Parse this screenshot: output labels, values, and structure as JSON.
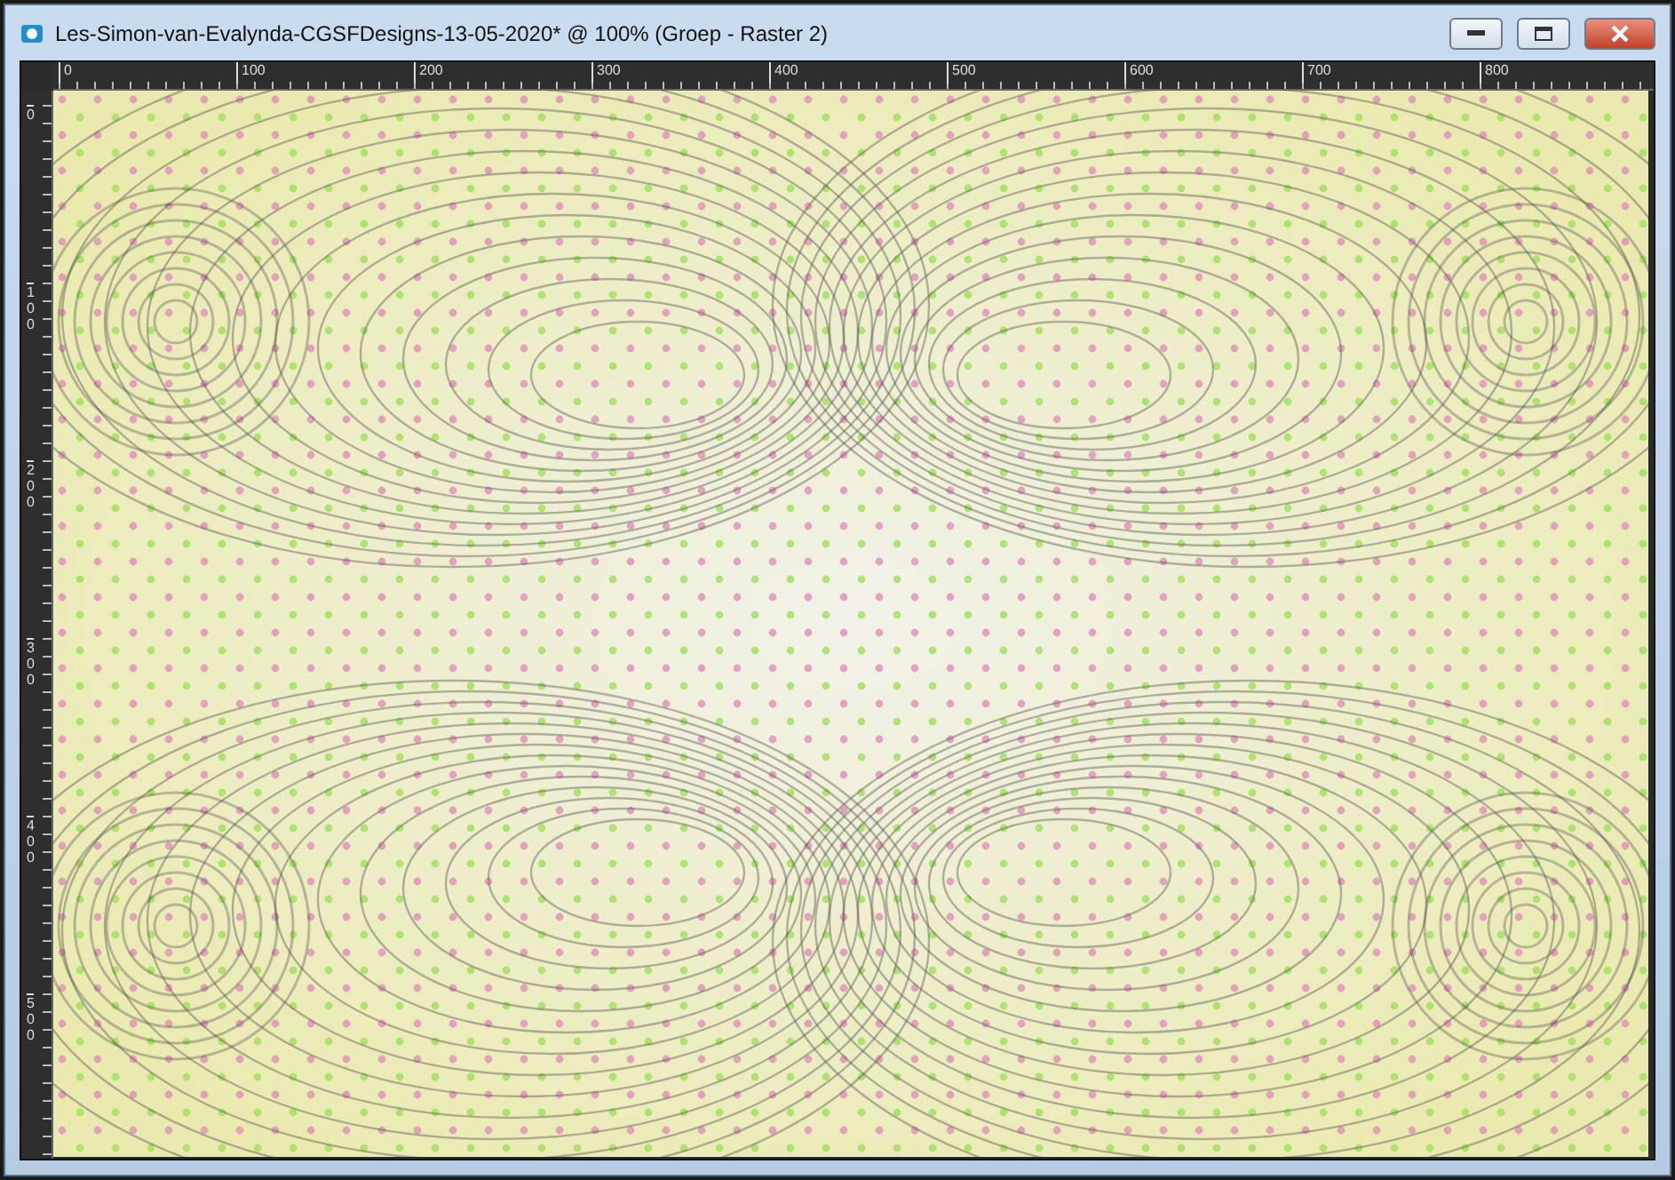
{
  "window": {
    "title": "Les-Simon-van-Evalynda-CGSFDesigns-13-05-2020* @ 100% (Groep - Raster 2)"
  },
  "title_buttons": [
    {
      "kind": "minimize"
    },
    {
      "kind": "maximize"
    },
    {
      "kind": "close"
    }
  ],
  "horizontal_ruler": {
    "labels": [
      "0",
      "100",
      "200",
      "300",
      "400",
      "500",
      "600",
      "700",
      "800"
    ]
  },
  "vertical_ruler": {
    "labels": [
      "0",
      "100",
      "200",
      "300",
      "400",
      "500"
    ]
  }
}
